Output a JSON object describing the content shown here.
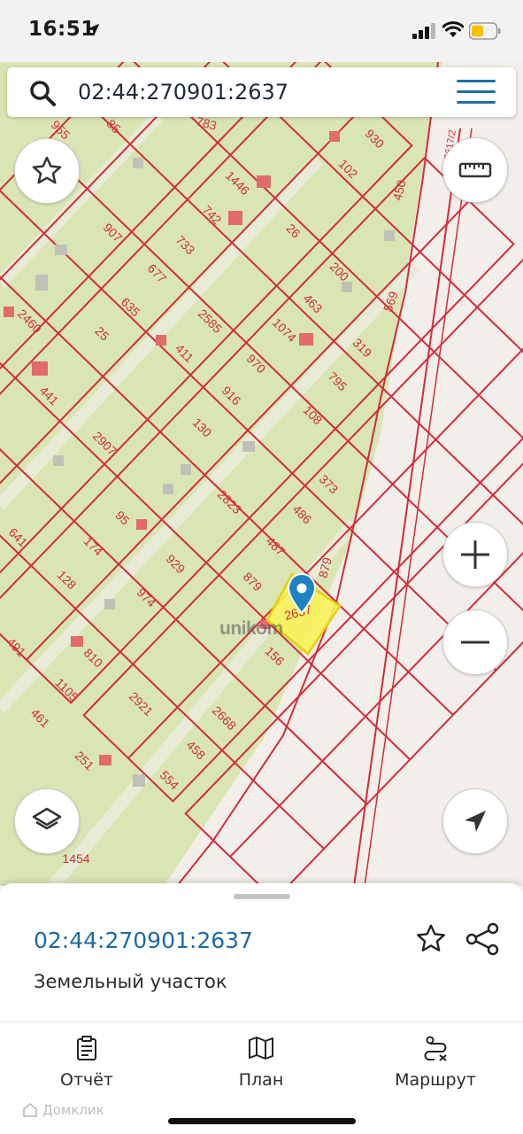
{
  "status_bar": {
    "time": "16:51"
  },
  "search": {
    "value": "02:44:270901:2637",
    "icon": "search-icon",
    "menu_icon": "hamburger-menu-icon"
  },
  "map": {
    "watermark": "unikom",
    "highlighted_parcel": "2637",
    "parcel_numbers": [
      "955",
      "85",
      "783",
      "930",
      "102",
      "450",
      "2617/2",
      "1446",
      "742",
      "907",
      "733",
      "26",
      "200",
      "677",
      "635",
      "463",
      "2585",
      "1074",
      "569",
      "2460",
      "25",
      "411",
      "970",
      "319",
      "441",
      "916",
      "795",
      "130",
      "108",
      "2907",
      "373",
      "2823",
      "95",
      "486",
      "641",
      "174",
      "929",
      "487",
      "879",
      "128",
      "974",
      "879",
      "491",
      "810",
      "156",
      "1105",
      "2921",
      "461",
      "2668",
      "458",
      "251",
      "554",
      "1454"
    ],
    "colors": {
      "land": "#d9e6b3",
      "boundary": "#d42b3a",
      "highlight": "#f7f25a",
      "marker": "#1f82c4",
      "building": "#e26a6a"
    }
  },
  "controls": {
    "favorite_icon": "star-outline-icon",
    "ruler_icon": "ruler-icon",
    "zoom_in_icon": "plus-icon",
    "zoom_out_icon": "minus-icon",
    "layers_icon": "layers-icon",
    "locate_icon": "navigation-arrow-icon"
  },
  "sheet": {
    "parcel_id": "02:44:270901:2637",
    "parcel_type": "Земельный участок",
    "favorite_icon": "star-outline-icon",
    "share_icon": "share-icon"
  },
  "tabbar": {
    "tabs": [
      {
        "label": "Отчёт",
        "icon": "clipboard-icon"
      },
      {
        "label": "План",
        "icon": "map-icon"
      },
      {
        "label": "Маршрут",
        "icon": "route-icon"
      }
    ]
  },
  "brand": {
    "label": "Домклик"
  }
}
